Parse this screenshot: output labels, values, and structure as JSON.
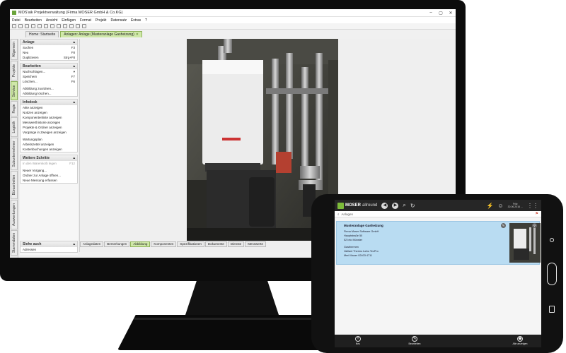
{
  "window": {
    "title": "MOS'aik Projektverwaltung (Firma MOSER GmbH & Co.KG)",
    "controls": [
      "–",
      "▢",
      "✕"
    ]
  },
  "menu": [
    "Datei",
    "Bearbeiten",
    "Ansicht",
    "Einfügen",
    "Format",
    "Projekt",
    "Datensatz",
    "Extras",
    "?"
  ],
  "tabs": [
    {
      "label": "Home: Startseite"
    },
    {
      "label": "Anlagen: Anlage (Musteranlage Gasheizung)",
      "close": "✕"
    }
  ],
  "vertical_tabs": [
    "Allgemein",
    "Projekte",
    "Service",
    "Regie",
    "Logistik",
    "Subunternehmer",
    "Büroarbeiten",
    "Auswertungen",
    "Stammdaten"
  ],
  "sidebar": {
    "anlage": {
      "header": "Anlage",
      "items": [
        {
          "label": "Suchen",
          "key": "F3"
        },
        {
          "label": "Neu",
          "key": "F8"
        },
        {
          "label": "Duplizieren",
          "key": "Strg+F8"
        }
      ]
    },
    "bearbeiten": {
      "header": "Bearbeiten",
      "items": [
        {
          "label": "Nachschlagen...",
          "key": "▾"
        },
        {
          "label": "Speichern",
          "key": "F7"
        },
        {
          "label": "Löschen...",
          "key": "F6"
        },
        {
          "label": "Abbildung zuordnen...",
          "key": ""
        },
        {
          "label": "Abbildung löschen...",
          "key": ""
        }
      ]
    },
    "infodesk": {
      "header": "Infodesk",
      "items": [
        {
          "label": "Akte anzeigen"
        },
        {
          "label": "Notizen anzeigen"
        },
        {
          "label": "Komponentenliste anzeigen"
        },
        {
          "label": "Messwerthistorie anzeigen"
        },
        {
          "label": "Projekte & Ordner anzeigen"
        },
        {
          "label": "Vorgänge in Zweigen anzeigen"
        },
        {
          "label": "Wartungsplan"
        },
        {
          "label": "Arbeitszettel anzeigen"
        },
        {
          "label": "Kostenbuchungen anzeigen"
        }
      ]
    },
    "weitere": {
      "header": "Weitere Schritte",
      "items": [
        {
          "label": "In den Warenkorb legen",
          "key": "F12"
        },
        {
          "label": "Neuer Vorgang...",
          "key": ""
        },
        {
          "label": "Ordner zur Anlage öffnen...",
          "key": ""
        },
        {
          "label": "Neue Messung erfassen",
          "key": ""
        }
      ]
    },
    "siehe": {
      "header": "Siehe auch",
      "items": [
        {
          "label": "Adressen"
        }
      ]
    }
  },
  "subtabs": [
    "Anlagedaten",
    "Bemerkungen",
    "Abbildung",
    "Komponenten",
    "Spezifikationen",
    "Dokumente",
    "Dienste",
    "Messwerte"
  ],
  "tablet": {
    "brand": "MOSER",
    "brand_sub": "allround",
    "nav": [
      "◀",
      "▶",
      "⌕",
      "↻"
    ],
    "user": [
      "Fritz",
      "30.06.2016 ..."
    ],
    "search_placeholder": "Anlagen",
    "result": {
      "title": "Musteranlage Gasheizung",
      "lines": [
        "Firma Moser Software GmbH",
        "Hauptstraße 50",
        "52 Ielo Münster",
        "",
        "Gasthermen",
        "Vaillant Thermo turbo TecPro",
        "Meri Mauer 02403 4711"
      ]
    },
    "footer": [
      {
        "icon": "+",
        "label": "Neu"
      },
      {
        "icon": "✎",
        "label": "Bearbeiten"
      },
      {
        "icon": "◉",
        "label": "Alle anzeigen"
      }
    ]
  },
  "colors": {
    "accent": "#cfe8a8",
    "accent_border": "#8fb35b",
    "logo": "#7dbb3a",
    "selection": "#b9dcf2"
  }
}
